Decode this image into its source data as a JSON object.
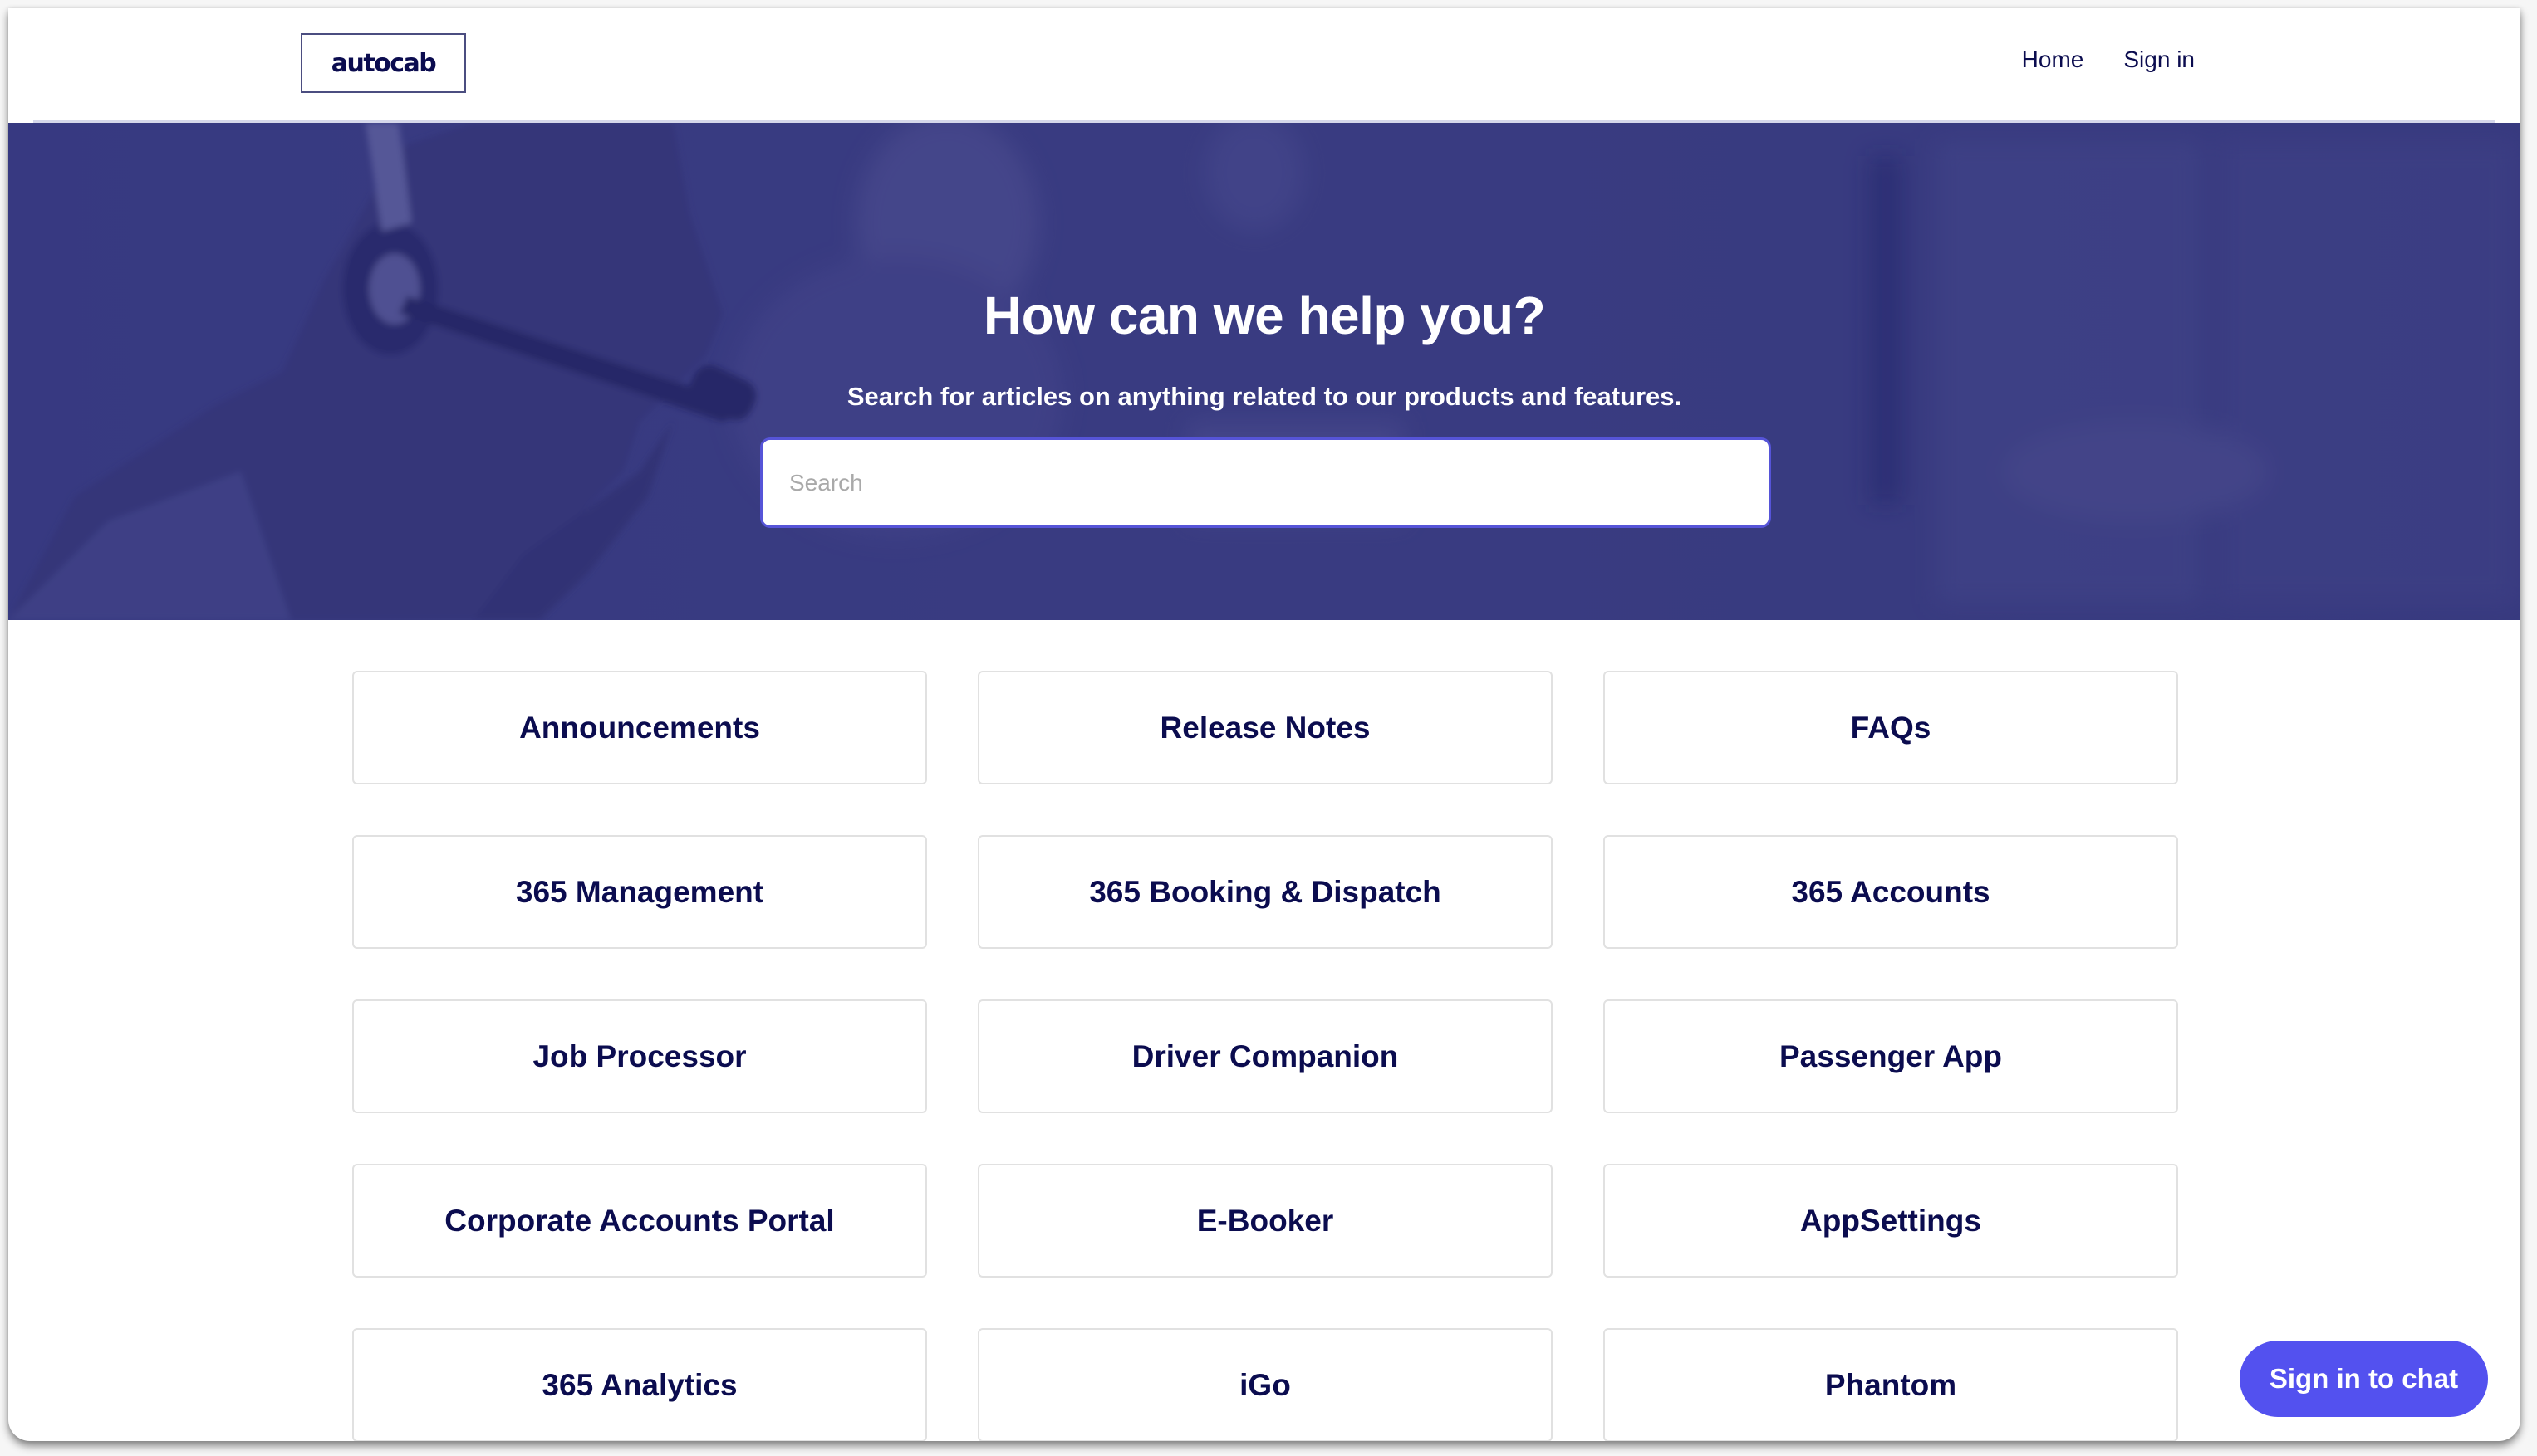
{
  "header": {
    "logo_text": "autocab",
    "nav": [
      {
        "label": "Home"
      },
      {
        "label": "Sign in"
      }
    ]
  },
  "hero": {
    "title": "How can we help you?",
    "subtitle": "Search for articles on anything related to our products and features.",
    "search": {
      "placeholder": "Search",
      "value": ""
    },
    "background_image": "customer-support-agents-with-headsets"
  },
  "categories": [
    {
      "label": "Announcements"
    },
    {
      "label": "Release Notes"
    },
    {
      "label": "FAQs"
    },
    {
      "label": "365 Management"
    },
    {
      "label": "365 Booking & Dispatch"
    },
    {
      "label": "365 Accounts"
    },
    {
      "label": "Job Processor"
    },
    {
      "label": "Driver Companion"
    },
    {
      "label": "Passenger App"
    },
    {
      "label": "Corporate Accounts Portal"
    },
    {
      "label": "E-Booker"
    },
    {
      "label": "AppSettings"
    },
    {
      "label": "365 Analytics"
    },
    {
      "label": "iGo"
    },
    {
      "label": "Phantom"
    }
  ],
  "chat": {
    "label": "Sign in to chat"
  },
  "colors": {
    "brand_navy": "#0b0c4f",
    "hero_overlay": "#3c3f7c",
    "accent": "#5351ef",
    "card_border": "#e1e1e1"
  }
}
